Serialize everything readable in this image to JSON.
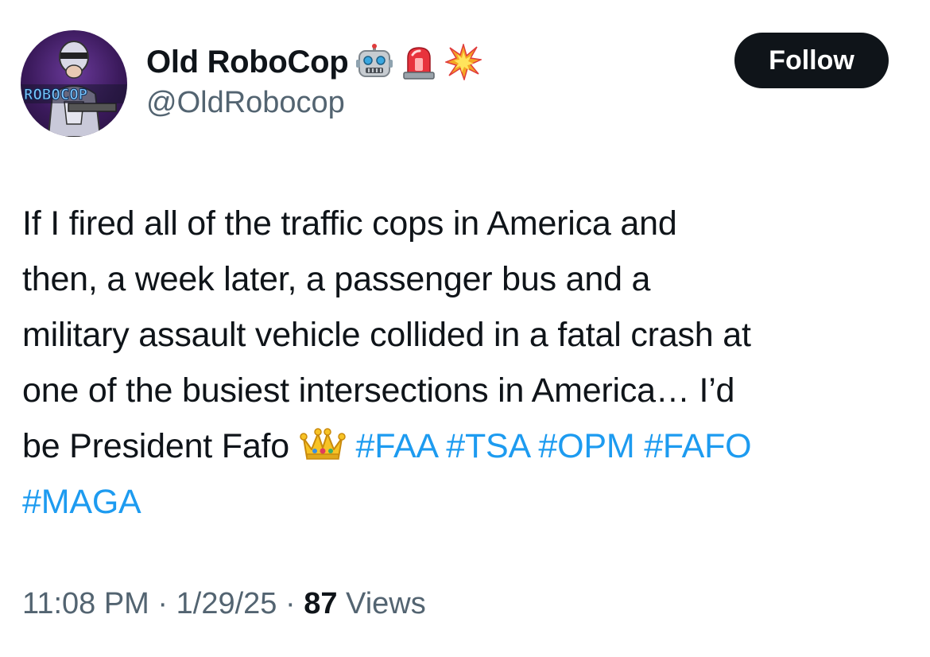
{
  "author": {
    "display_name": "Old RoboCop",
    "handle": "@OldRobocop",
    "name_emojis": [
      "robot-face",
      "police-light",
      "collision"
    ],
    "avatar_text": "ROBOCOP"
  },
  "actions": {
    "follow_label": "Follow"
  },
  "tweet": {
    "line1": "If I fired all of the traffic cops in America and",
    "line2": "then, a week later, a passenger bus and a",
    "line3": "military assault vehicle collided in a fatal crash at",
    "line4": "one of the busiest intersections in America… I’d",
    "line5_text": "be President Fafo ",
    "line5_emoji": "crown",
    "hashtags": [
      "#FAA",
      "#TSA",
      "#OPM",
      "#FAFO",
      "#MAGA"
    ]
  },
  "meta": {
    "time": "11:08 PM",
    "separator": " · ",
    "date": "1/29/25",
    "views_count": "87",
    "views_label": " Views"
  },
  "colors": {
    "text": "#0f1419",
    "secondary": "#536471",
    "link": "#1d9bf0",
    "button_bg": "#0f1419"
  }
}
